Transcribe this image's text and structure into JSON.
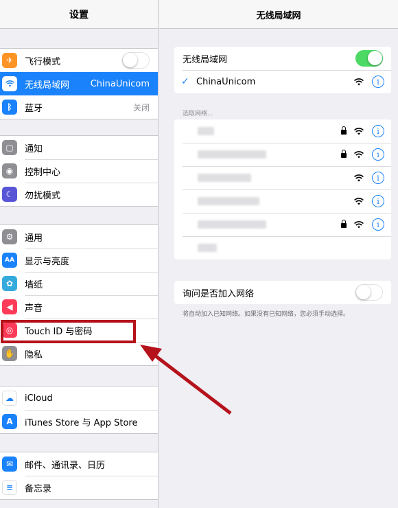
{
  "left": {
    "title": "设置",
    "groups": [
      [
        {
          "label": "飞行模式",
          "icon": "airplane-icon",
          "color": "#fd9426",
          "toggle": false
        },
        {
          "label": "无线局域网",
          "icon": "wifi-icon",
          "color": "#1a82fb",
          "value": "ChinaUnicom",
          "selected": true
        },
        {
          "label": "蓝牙",
          "icon": "bluetooth-icon",
          "color": "#1a82fb",
          "value": "关闭"
        }
      ],
      [
        {
          "label": "通知",
          "icon": "notifications-icon",
          "color": "#8e8e93"
        },
        {
          "label": "控制中心",
          "icon": "control-center-icon",
          "color": "#8e8e93"
        },
        {
          "label": "勿扰模式",
          "icon": "moon-icon",
          "color": "#5856d6"
        }
      ],
      [
        {
          "label": "通用",
          "icon": "gear-icon",
          "color": "#8e8e93"
        },
        {
          "label": "显示与亮度",
          "icon": "display-icon",
          "color": "#1a82fb"
        },
        {
          "label": "墙纸",
          "icon": "wallpaper-icon",
          "color": "#35aadc"
        },
        {
          "label": "声音",
          "icon": "sound-icon",
          "color": "#fd3b58"
        },
        {
          "label": "Touch ID 与密码",
          "icon": "fingerprint-icon",
          "color": "#fd3b58"
        },
        {
          "label": "隐私",
          "icon": "hand-icon",
          "color": "#8e8e93"
        }
      ],
      [
        {
          "label": "iCloud",
          "icon": "cloud-icon",
          "color": "#ffffff"
        },
        {
          "label": "iTunes Store 与 App Store",
          "icon": "app-store-icon",
          "color": "#1a82fb"
        }
      ],
      [
        {
          "label": "邮件、通讯录、日历",
          "icon": "mail-icon",
          "color": "#1a82fb"
        },
        {
          "label": "备忘录",
          "icon": "notes-icon",
          "color": "#ffffff"
        }
      ]
    ]
  },
  "right": {
    "title": "无线局域网",
    "wifi_label": "无线局域网",
    "wifi_on": true,
    "connected_network": "ChinaUnicom",
    "choose_network_header": "选取网络...",
    "networks": [
      {
        "locked": true,
        "blur_width": 24
      },
      {
        "locked": true,
        "blur_width": 100
      },
      {
        "locked": false,
        "blur_width": 78
      },
      {
        "locked": false,
        "blur_width": 90
      },
      {
        "locked": true,
        "blur_width": 100
      },
      {
        "locked": false,
        "blur_width": 28,
        "no_icons": true
      }
    ],
    "ask_join_label": "询问是否加入网络",
    "ask_join_on": false,
    "ask_join_hint": "将自动加入已知网络。如果没有已知网络，您必须手动选择。"
  },
  "colors": {
    "accent": "#1a82fb",
    "annotation": "#b5121b",
    "switch_on": "#4cd964"
  }
}
